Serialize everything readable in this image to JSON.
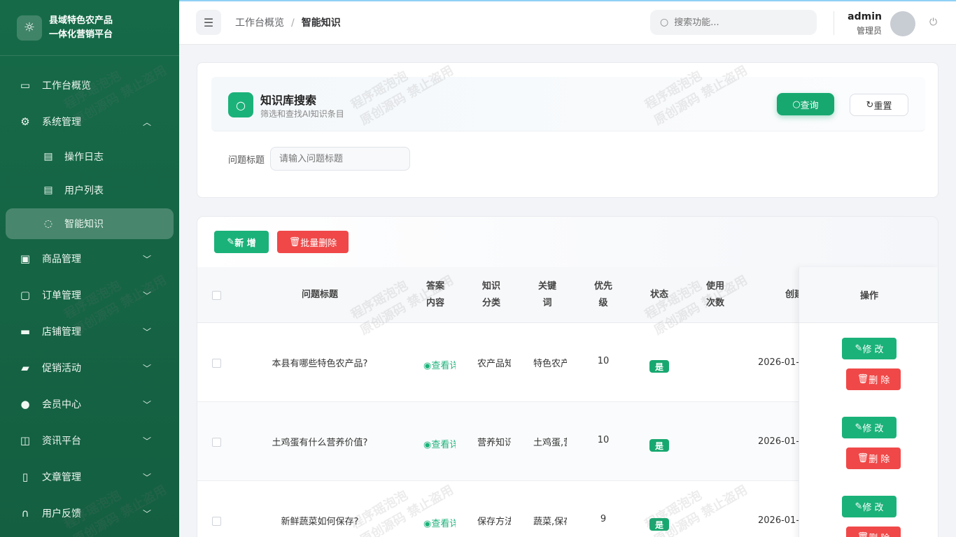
{
  "app": {
    "title_line1": "县域特色农产品",
    "title_line2": "一体化营销平台"
  },
  "sidebar": {
    "items": [
      {
        "label": "工作台概览",
        "icon": "presentation-icon"
      },
      {
        "label": "系统管理",
        "icon": "gear-icon",
        "expanded": true
      },
      {
        "label": "操作日志",
        "icon": "document-icon",
        "sub": true
      },
      {
        "label": "用户列表",
        "icon": "document-icon",
        "sub": true
      },
      {
        "label": "智能知识",
        "icon": "chat-icon",
        "sub": true,
        "active": true
      },
      {
        "label": "商品管理",
        "icon": "box-icon"
      },
      {
        "label": "订单管理",
        "icon": "bag-icon"
      },
      {
        "label": "店铺管理",
        "icon": "shop-icon"
      },
      {
        "label": "促销活动",
        "icon": "ticket-icon"
      },
      {
        "label": "会员中心",
        "icon": "user-icon"
      },
      {
        "label": "资讯平台",
        "icon": "book-icon"
      },
      {
        "label": "文章管理",
        "icon": "notebook-icon"
      },
      {
        "label": "用户反馈",
        "icon": "headset-icon"
      }
    ]
  },
  "header": {
    "breadcrumb": [
      "工作台概览",
      "智能知识"
    ],
    "search_placeholder": "搜索功能...",
    "user_name": "admin",
    "user_role": "管理员"
  },
  "search_card": {
    "title": "知识库搜索",
    "subtitle": "筛选和查找AI知识条目",
    "query_label": "查询",
    "reset_label": "重置",
    "field_label": "问题标题",
    "field_placeholder": "请输入问题标题"
  },
  "table": {
    "add_label": "新 增",
    "batch_delete_label": "批量删除",
    "headers": {
      "title": "问题标题",
      "answer_1": "答案",
      "answer_2": "内容",
      "category_1": "知识",
      "category_2": "分类",
      "keyword_1": "关键",
      "keyword_2": "词",
      "priority_1": "优先",
      "priority_2": "级",
      "status": "状态",
      "usage_1": "使用",
      "usage_2": "次数",
      "created": "创建",
      "ops": "操作"
    },
    "rows": [
      {
        "title": "本县有哪些特色农产品?",
        "answer": "查看详情",
        "category": "农产品知识",
        "keyword": "特色农产品",
        "priority": "10",
        "status": "是",
        "created": "2026-01-"
      },
      {
        "title": "土鸡蛋有什么营养价值?",
        "answer": "查看详情",
        "category": "营养知识",
        "keyword": "土鸡蛋,营养",
        "priority": "10",
        "status": "是",
        "created": "2026-01-"
      },
      {
        "title": "新鲜蔬菜如何保存?",
        "answer": "查看详情",
        "category": "保存方法",
        "keyword": "蔬菜,保存",
        "priority": "9",
        "status": "是",
        "created": "2026-01-"
      }
    ],
    "edit_label": "修 改",
    "delete_label": "删 除"
  },
  "watermark": {
    "line1": "程序瑶泡泡",
    "line2": "原创源码 禁止盗用"
  },
  "colors": {
    "sidebar": "#166a48",
    "primary": "#1bb27a",
    "danger": "#f04848"
  }
}
